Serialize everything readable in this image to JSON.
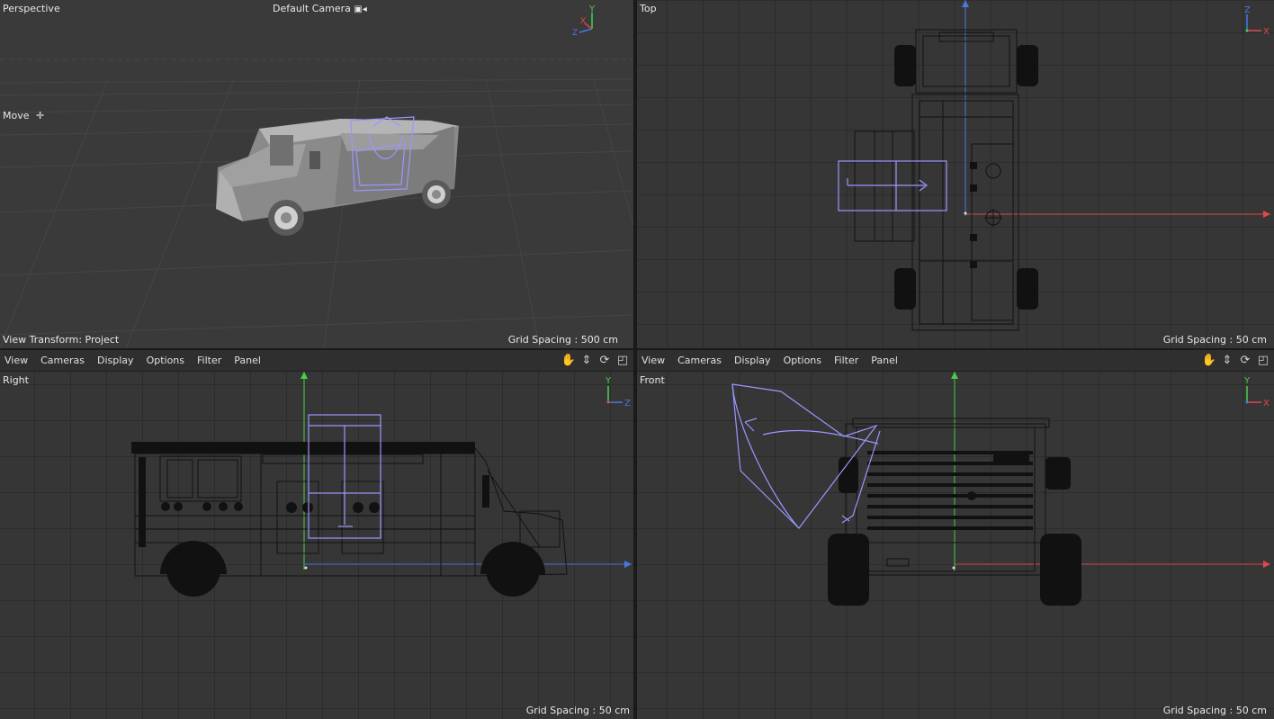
{
  "viewports": {
    "perspective": {
      "name": "Perspective",
      "camera": "Default Camera",
      "camera_icon": "camera-icon",
      "tool": "Move",
      "tool_icon": "move-icon",
      "view_transform": "View Transform: Project",
      "grid_spacing": "Grid Spacing : 500 cm"
    },
    "top": {
      "name": "Top",
      "grid_spacing": "Grid Spacing : 50 cm",
      "axes": {
        "a": "Z",
        "b": "X"
      }
    },
    "right": {
      "name": "Right",
      "grid_spacing": "Grid Spacing : 50 cm",
      "axes": {
        "a": "Y",
        "b": "Z"
      }
    },
    "front": {
      "name": "Front",
      "grid_spacing": "Grid Spacing : 50 cm",
      "axes": {
        "a": "Y",
        "b": "X"
      }
    }
  },
  "persp_axes": {
    "y": "Y",
    "x": "X",
    "z": "Z"
  },
  "menu": [
    "View",
    "Cameras",
    "Display",
    "Options",
    "Filter",
    "Panel"
  ],
  "toolbar_icons": [
    "pan-hand-icon",
    "move-arrows-icon",
    "rotate-icon",
    "maximize-icon"
  ],
  "colors": {
    "axis_x": "#e04848",
    "axis_y": "#48d048",
    "axis_z": "#4878e0",
    "selection": "#9a96ff",
    "wire": "#111111"
  }
}
